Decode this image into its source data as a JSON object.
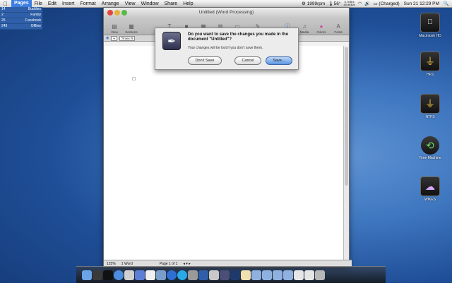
{
  "menubar": {
    "apple": "",
    "app_name": "Pages",
    "menus": [
      "File",
      "Edit",
      "Insert",
      "Format",
      "Arrange",
      "View",
      "Window",
      "Share",
      "Help"
    ],
    "status": {
      "fan_speed": "1999rpm",
      "temp": "56°",
      "net_up": "0.7KB/s",
      "net_down": "30.9KB/s",
      "battery": "(Charged)",
      "date": "Sun 21 12:29 PM"
    }
  },
  "buddy_list": [
    {
      "count": "14",
      "label": "Buddies"
    },
    {
      "count": "2",
      "label": "Family"
    },
    {
      "count": "25",
      "label": "Facebook"
    },
    {
      "count": "249",
      "label": "Offline"
    }
  ],
  "desktop_icons": [
    "Macintosh HD",
    "HFS",
    "NTFS",
    "Time Machine",
    "WIKES"
  ],
  "window": {
    "title": "Untitled (Word Processing)",
    "toolbar_left": [
      "View",
      "Sections"
    ],
    "toolbar_middle": [
      "Text Box",
      "Shapes",
      "Table",
      "Charts",
      "Comment",
      "Track Changes"
    ],
    "toolbar_right": [
      "Inspector",
      "Media",
      "Colors",
      "Fonts"
    ],
    "style_selector": "Times R",
    "status": {
      "zoom": "125%",
      "words": "1 Word",
      "page": "Page 1 of 1"
    }
  },
  "dialog": {
    "message": "Do you want to save the changes you made in the document \"Untitled\"?",
    "info": "Your changes will be lost if you don’t save them.",
    "dont_save": "Don’t Save",
    "cancel": "Cancel",
    "save": "Save..."
  },
  "colors": {
    "accent": "#3c7ee0",
    "desktop": "#2a5aa6"
  }
}
